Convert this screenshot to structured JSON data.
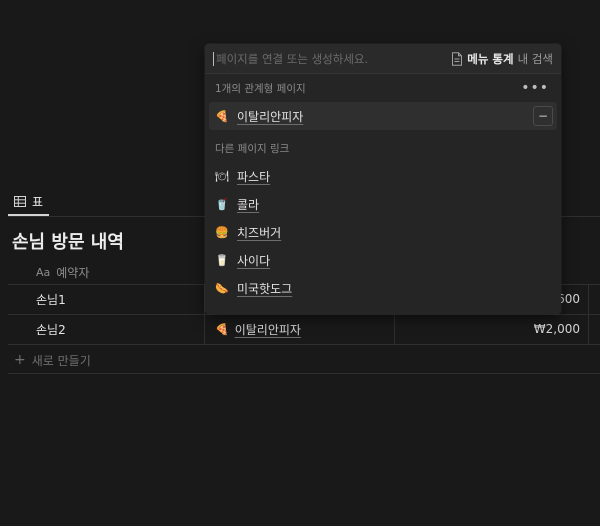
{
  "view_tab": {
    "label": "표"
  },
  "database": {
    "title": "손님 방문 내역",
    "column_name": "예약자",
    "rows": [
      {
        "name": "손님1",
        "relation": "",
        "price": "₩1,600"
      },
      {
        "name": "손님2",
        "relation": "이탈리안피자",
        "price": "₩2,000"
      }
    ],
    "new_row_label": "새로 만들기"
  },
  "popup": {
    "search_placeholder": "페이지를 연결 또는 생성하세요.",
    "scope_db": "메뉴 통계",
    "scope_suffix": "내 검색",
    "linked_section": "1개의 관계형 페이지",
    "linked_items": [
      {
        "emoji": "pizza",
        "label": "이탈리안피자"
      }
    ],
    "other_section": "다른 페이지 링크",
    "other_items": [
      {
        "emoji": "plate",
        "label": "파스타"
      },
      {
        "emoji": "cup",
        "label": "콜라"
      },
      {
        "emoji": "burger",
        "label": "치즈버거"
      },
      {
        "emoji": "cup",
        "label": "사이다"
      },
      {
        "emoji": "hotdog",
        "label": "미국핫도그"
      }
    ]
  },
  "colors": {
    "background": "#191919",
    "popup": "#252525"
  }
}
